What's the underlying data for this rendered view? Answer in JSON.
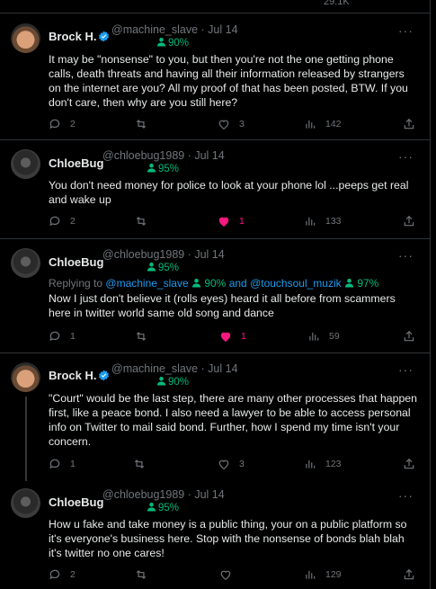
{
  "accent": "#1d9bf0",
  "verified_color": "#1d9bf0",
  "score_color": "#00ba7c",
  "like_color": "#f91880",
  "top": {
    "views": "29.1K"
  },
  "tweets": [
    {
      "name": "Brock H.",
      "verified": true,
      "handle": "@machine_slave · Jul 14",
      "score": "90%",
      "text": "It may be \"nonsense\" to you, but then you're not the one getting phone calls, death threats and having all their information released by strangers on the internet are you?  All my proof of that has been posted, BTW.  If you don't care, then why are you still here?",
      "replies": "2",
      "reposts": "",
      "likes": "3",
      "views": "142",
      "liked": false
    },
    {
      "name": "ChloeBug",
      "verified": false,
      "handle": "@chloebug1989 · Jul 14",
      "score": "95%",
      "text": "You don't need money for police to look at your phone lol ...peeps get real and wake up",
      "replies": "2",
      "reposts": "",
      "likes": "1",
      "views": "133",
      "liked": true
    },
    {
      "name": "ChloeBug",
      "verified": false,
      "handle": "@chloebug1989 · Jul 14",
      "score": "95%",
      "reply_prefix": "Replying to",
      "reply_user1": "@machine_slave",
      "reply_score1": "90%",
      "reply_and": "and",
      "reply_user2": "@touchsoul_muzik",
      "reply_score2": "97%",
      "text": "Now I just don't believe it (rolls eyes) heard it all before from scammers here in twitter world same old song and dance",
      "replies": "1",
      "reposts": "",
      "likes": "1",
      "views": "59",
      "liked": true
    },
    {
      "name": "Brock H.",
      "verified": true,
      "handle": "@machine_slave · Jul 14",
      "score": "90%",
      "text": "\"Court\" would be the last step, there are many other processes that happen first, like a peace bond.  I also need a lawyer to be able to access personal info on Twitter to mail said bond.  Further, how I spend my time isn't your concern.",
      "replies": "1",
      "reposts": "",
      "likes": "3",
      "views": "123",
      "liked": false
    },
    {
      "name": "ChloeBug",
      "verified": false,
      "handle": "@chloebug1989 · Jul 14",
      "score": "95%",
      "text": "How u fake and take money is a public thing, your on a public platform so it's everyone's business here. Stop with the nonsense of bonds blah blah it's twitter no one cares!",
      "replies": "2",
      "reposts": "",
      "likes": "",
      "views": "129",
      "liked": false
    }
  ]
}
